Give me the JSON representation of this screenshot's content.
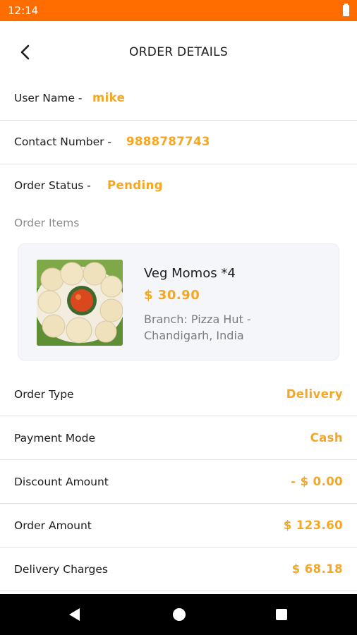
{
  "status_bar": {
    "time": "12:14"
  },
  "header": {
    "title": "ORDER DETAILS"
  },
  "user": {
    "label": "User Name -",
    "value": "mike"
  },
  "contact": {
    "label": "Contact Number -",
    "value": "9888787743"
  },
  "order_status": {
    "label": "Order Status -",
    "value": "Pending"
  },
  "order_items_label": "Order Items",
  "items": [
    {
      "name": "Veg Momos *4",
      "price": "$ 30.90",
      "branch": "Branch: Pizza Hut - Chandigarh, India"
    }
  ],
  "summary": [
    {
      "label": "Order Type",
      "value": "Delivery"
    },
    {
      "label": "Payment Mode",
      "value": "Cash"
    },
    {
      "label": "Discount Amount",
      "value": "- $ 0.00"
    },
    {
      "label": "Order Amount",
      "value": "$ 123.60"
    },
    {
      "label": "Delivery Charges",
      "value": "$ 68.18"
    }
  ],
  "colors": {
    "status_bar": "#ff6d00",
    "accent": "#f5a623",
    "nav_bar": "#000000"
  },
  "icons": {
    "back": "back-arrow-icon",
    "battery": "battery-icon",
    "nav_back": "nav-back-icon",
    "nav_home": "nav-home-icon",
    "nav_recents": "nav-recents-icon"
  }
}
